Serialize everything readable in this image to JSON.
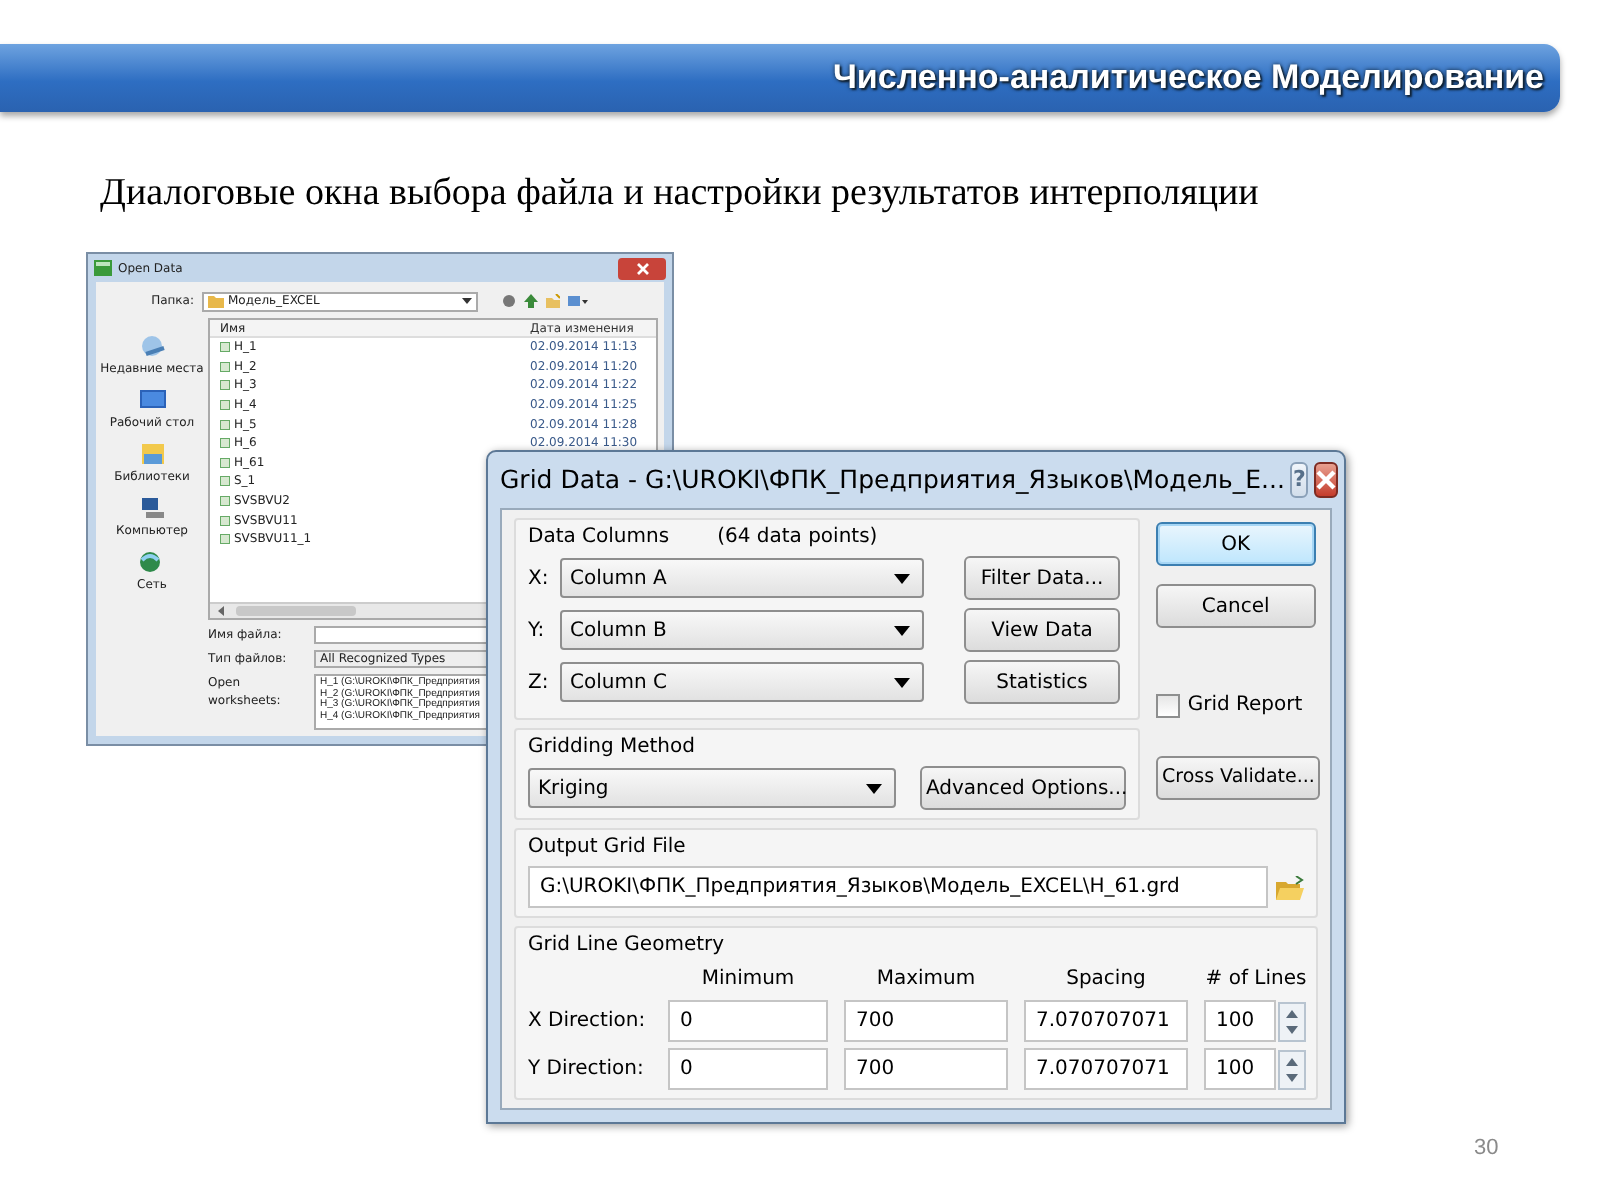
{
  "slide": {
    "title": "Численно-аналитическое Моделирование",
    "subtitle": "Диалоговые окна выбора файла и настройки результатов интерполяции",
    "page_number": "30"
  },
  "open_data_dialog": {
    "title": "Open Data",
    "folder_label": "Папка:",
    "folder": "Модель_EXCEL",
    "places": [
      {
        "label": "Недавние места"
      },
      {
        "label": "Рабочий стол"
      },
      {
        "label": "Библиотеки"
      },
      {
        "label": "Компьютер"
      },
      {
        "label": "Сеть"
      }
    ],
    "columns": [
      "Имя",
      "Дата изменения"
    ],
    "files": [
      {
        "name": "H_1",
        "date": "02.09.2014 11:13"
      },
      {
        "name": "H_2",
        "date": "02.09.2014 11:20"
      },
      {
        "name": "H_3",
        "date": "02.09.2014 11:22"
      },
      {
        "name": "H_4",
        "date": "02.09.2014 11:25"
      },
      {
        "name": "H_5",
        "date": "02.09.2014 11:28"
      },
      {
        "name": "H_6",
        "date": "02.09.2014 11:30"
      },
      {
        "name": "H_61"
      },
      {
        "name": "S_1"
      },
      {
        "name": "SVSBVU2"
      },
      {
        "name": "SVSBVU11"
      },
      {
        "name": "SVSBVU11_1"
      }
    ],
    "file_name_label": "Имя файла:",
    "file_type_label": "Тип файлов:",
    "file_type": "All Recognized Types",
    "worksheets_label": "Open worksheets:",
    "worksheets": [
      "H_1 (G:\\UROKI\\ФПК_Предприятия",
      "H_2 (G:\\UROKI\\ФПК_Предприятия",
      "H_3 (G:\\UROKI\\ФПК_Предприятия",
      "H_4 (G:\\UROKI\\ФПК_Предприятия"
    ]
  },
  "grid_data_dialog": {
    "title": "Grid Data - G:\\UROKI\\ФПК_Предприятия_Языков\\Модель_E...",
    "help": "?",
    "data_columns": {
      "label": "Data Columns",
      "count": "(64 data points)",
      "rows": [
        {
          "axis": "X:",
          "value": "Column A",
          "button": "Filter Data..."
        },
        {
          "axis": "Y:",
          "value": "Column B",
          "button": "View Data"
        },
        {
          "axis": "Z:",
          "value": "Column C",
          "button": "Statistics"
        }
      ]
    },
    "buttons": [
      {
        "label": "OK",
        "default": true
      },
      {
        "label": "Cancel",
        "default": false
      }
    ],
    "grid_report": {
      "label": "Grid Report",
      "checked": false
    },
    "gridding_method": {
      "label": "Gridding Method",
      "value": "Kriging",
      "button": "Advanced Options..."
    },
    "cross_validate": "Cross Validate...",
    "output_grid_file": {
      "label": "Output Grid File",
      "value": "G:\\UROKI\\ФПК_Предприятия_Языков\\Модель_EXCEL\\H_61.grd"
    },
    "geometry": {
      "label": "Grid Line Geometry",
      "columns": [
        "Minimum",
        "Maximum",
        "Spacing",
        "# of Lines"
      ],
      "rows": [
        {
          "label": "X Direction:",
          "minimum": "0",
          "maximum": "700",
          "spacing": "7.070707071",
          "lines": "100"
        },
        {
          "label": "Y Direction:",
          "minimum": "0",
          "maximum": "700",
          "spacing": "7.070707071",
          "lines": "100"
        }
      ]
    }
  }
}
